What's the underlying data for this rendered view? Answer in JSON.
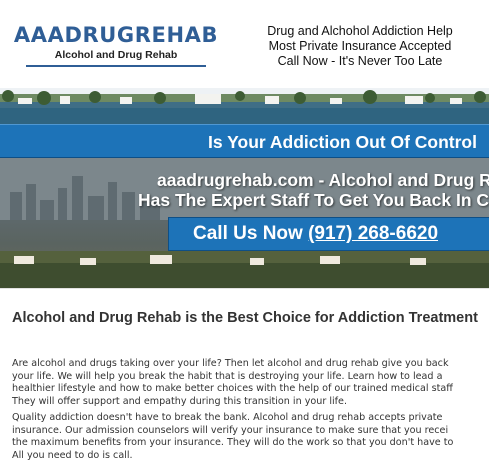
{
  "logo": {
    "title": "AAADRUGREHAB",
    "subtitle": "Alcohol and Drug Rehab"
  },
  "header_info": {
    "line1": "Drug and Alchohol Addiction Help",
    "line2": "Most Private Insurance Accepted",
    "line3": "Call Now - It's Never Too Late"
  },
  "hero": {
    "banner_top": "Is Your Addiction Out Of Control",
    "line1": "aaadrugrehab.com - Alcohol and Drug Re",
    "line2": "Has The Expert Staff To Get You Back In C",
    "call_label": "Call Us Now",
    "phone": "(917) 268-6620"
  },
  "article": {
    "title": "Alcohol and Drug Rehab is the Best Choice for Addiction Treatment",
    "para1": [
      "Are alcohol and drugs taking over your life? Then let alcohol and drug rehab give you back",
      "your life. We will help you break the habit that is destroying your life. Learn how to lead a",
      "healthier lifestyle and how to make better choices with the help of our trained medical staff",
      "They will offer support and empathy during this transition in your life."
    ],
    "para2": [
      "Quality addiction doesn't have to break the bank. Alcohol and drug rehab accepts private",
      "insurance. Our admission counselors will verify your insurance to make sure that you recei",
      "the maximum benefits from your insurance. They will do the work so that you don't have to",
      "All you need to do is call."
    ]
  },
  "colors": {
    "brand_blue": "#2f5e96",
    "banner_blue": "#1d73b8",
    "text": "#333333"
  }
}
